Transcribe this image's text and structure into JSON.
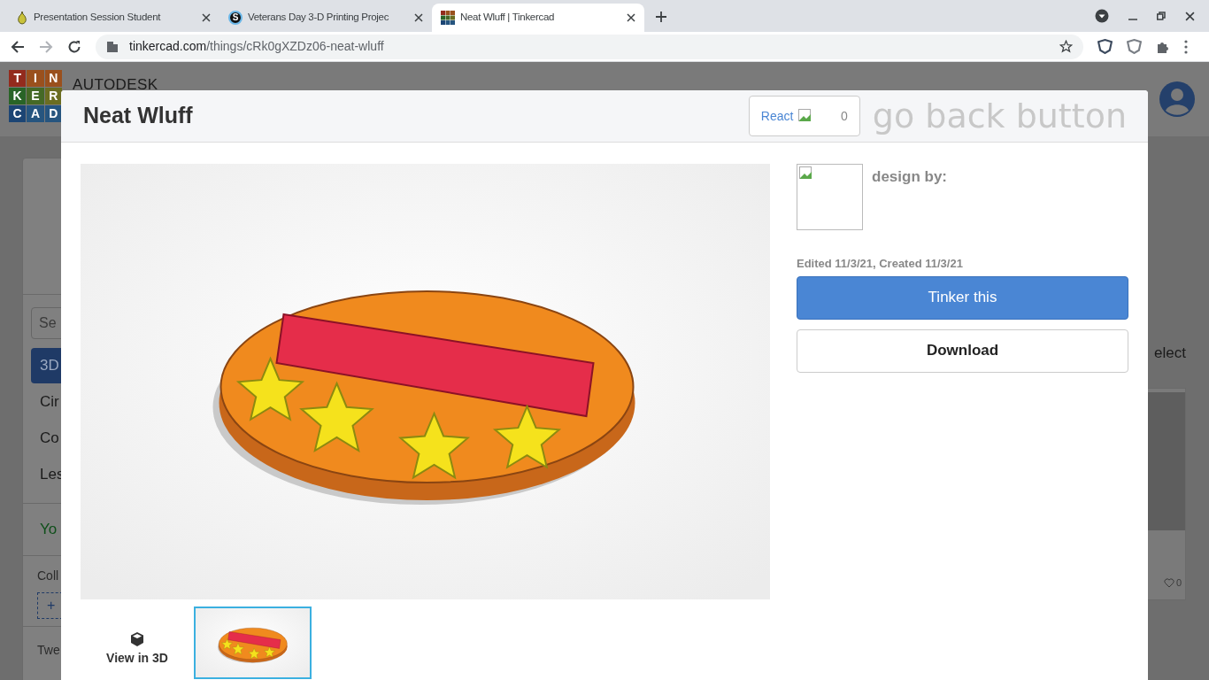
{
  "browser": {
    "tabs": [
      {
        "title": "Presentation Session Student",
        "kind": "pear",
        "selected": false
      },
      {
        "title": "Veterans Day 3-D Printing Projec",
        "kind": "letter",
        "favicon_text": "S",
        "selected": false
      },
      {
        "title": "Neat Wluff | Tinkercad",
        "kind": "grid",
        "selected": true
      }
    ],
    "url_host": "tinkercad.com",
    "url_path": "/things/cRk0gXZDz06-neat-wluff"
  },
  "site": {
    "logo_letters": [
      {
        "text": "T",
        "color": "#932b1d"
      },
      {
        "text": "I",
        "color": "#9a501d"
      },
      {
        "text": "N",
        "color": "#9a501d"
      },
      {
        "text": "K",
        "color": "#296427"
      },
      {
        "text": "E",
        "color": "#456926"
      },
      {
        "text": "R",
        "color": "#6b6d21"
      },
      {
        "text": "C",
        "color": "#1c4574"
      },
      {
        "text": "A",
        "color": "#26557f"
      },
      {
        "text": "D",
        "color": "#26557f"
      }
    ],
    "brand": "AUTODESK",
    "sidebar": {
      "search_placeholder": "Se",
      "items": [
        {
          "label": "3D",
          "selected": true
        },
        {
          "label": "Cir",
          "selected": false
        },
        {
          "label": "Co",
          "selected": false
        },
        {
          "label": "Les",
          "selected": false
        }
      ],
      "your_link": "Yo",
      "collections_label": "Coll",
      "add_label": "+",
      "footer_label": "Twe"
    },
    "select_label": "elect",
    "card_likes": "0"
  },
  "modal": {
    "title": "Neat Wluff",
    "react_label": "React",
    "react_count": "0",
    "back_alt": "go back button",
    "design_by": "design by:",
    "dates": "Edited 11/3/21, Created 11/3/21",
    "primary_button": "Tinker this",
    "secondary_button": "Download",
    "view_3d": "View in 3D",
    "thumbnails": [
      {
        "selected": true
      }
    ]
  }
}
